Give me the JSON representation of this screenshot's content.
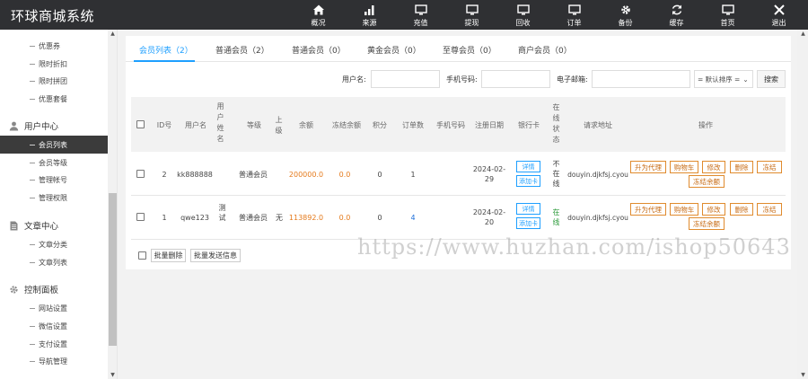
{
  "app": {
    "title": "环球商城系统"
  },
  "topnav": [
    {
      "label": "概况",
      "icon": "home-icon"
    },
    {
      "label": "来源",
      "icon": "bar-chart-icon"
    },
    {
      "label": "充值",
      "icon": "monitor-icon"
    },
    {
      "label": "提现",
      "icon": "monitor-icon"
    },
    {
      "label": "回收",
      "icon": "monitor-icon"
    },
    {
      "label": "订单",
      "icon": "monitor-icon"
    },
    {
      "label": "备份",
      "icon": "gear-icon"
    },
    {
      "label": "缓存",
      "icon": "refresh-icon"
    },
    {
      "label": "首页",
      "icon": "monitor-icon"
    },
    {
      "label": "退出",
      "icon": "close-icon"
    }
  ],
  "sidebar": {
    "promo_items": [
      "优惠券",
      "限时折扣",
      "限时拼团",
      "优惠套餐"
    ],
    "user_center": {
      "title": "用户中心",
      "items": [
        "会员列表",
        "会员等级",
        "管理帐号",
        "管理权限"
      ]
    },
    "article_center": {
      "title": "文章中心",
      "items": [
        "文章分类",
        "文章列表"
      ]
    },
    "control_panel": {
      "title": "控制面板",
      "items": [
        "网站设置",
        "微信设置",
        "支付设置",
        "导航管理"
      ]
    }
  },
  "tabs": [
    "会员列表（2）",
    "普通会员（2）",
    "普通会员（0）",
    "黄金会员（0）",
    "至尊会员（0）",
    "商户会员（0）"
  ],
  "search": {
    "username_label": "用户名:",
    "phone_label": "手机号码:",
    "email_label": "电子邮箱:",
    "sort_value": "= 默认排序 =",
    "search_button": "搜索"
  },
  "table": {
    "headers": {
      "id": "ID号",
      "username": "用户名",
      "realname": "用户姓名",
      "level": "等级",
      "superior": "上级",
      "balance": "余额",
      "frozen": "冻结余额",
      "points": "积分",
      "orders": "订单数",
      "phone": "手机号码",
      "regdate": "注册日期",
      "bankcard": "银行卡",
      "online": "在线状态",
      "request_url": "请求地址",
      "actions": "操作"
    },
    "rows": [
      {
        "id": "2",
        "username": "kk888888",
        "realname": "",
        "level": "普通会员",
        "superior": "",
        "balance": "200000.0",
        "frozen": "0.0",
        "points": "0",
        "orders": "1",
        "phone": "",
        "regdate": "2024-02-29",
        "detail": "详情",
        "add_card": "添加卡",
        "online": "不在线",
        "request_url": "douyin.djkfsj.cyou"
      },
      {
        "id": "1",
        "username": "qwe123",
        "realname": "测试",
        "level": "普通会员",
        "superior": "无",
        "balance": "113892.0",
        "frozen": "0.0",
        "points": "0",
        "orders": "4",
        "phone": "",
        "regdate": "2024-02-20",
        "detail": "详情",
        "add_card": "添加卡",
        "online": "在线",
        "request_url": "douyin.djkfsj.cyou"
      }
    ],
    "row_actions": {
      "upgrade": "升为代理",
      "cart": "购物车",
      "edit": "修改",
      "delete": "删除",
      "freeze": "冻结",
      "unfreeze": "冻结余额"
    }
  },
  "footer": {
    "batch_delete": "批量删除",
    "batch_message": "批量发送信息"
  },
  "watermark": "https://www.huzhan.com/ishop50643",
  "colors": {
    "topbar": "#2f3033",
    "accent": "#1e9fff",
    "orange": "#e57b1d",
    "green": "#2c9a3a"
  }
}
